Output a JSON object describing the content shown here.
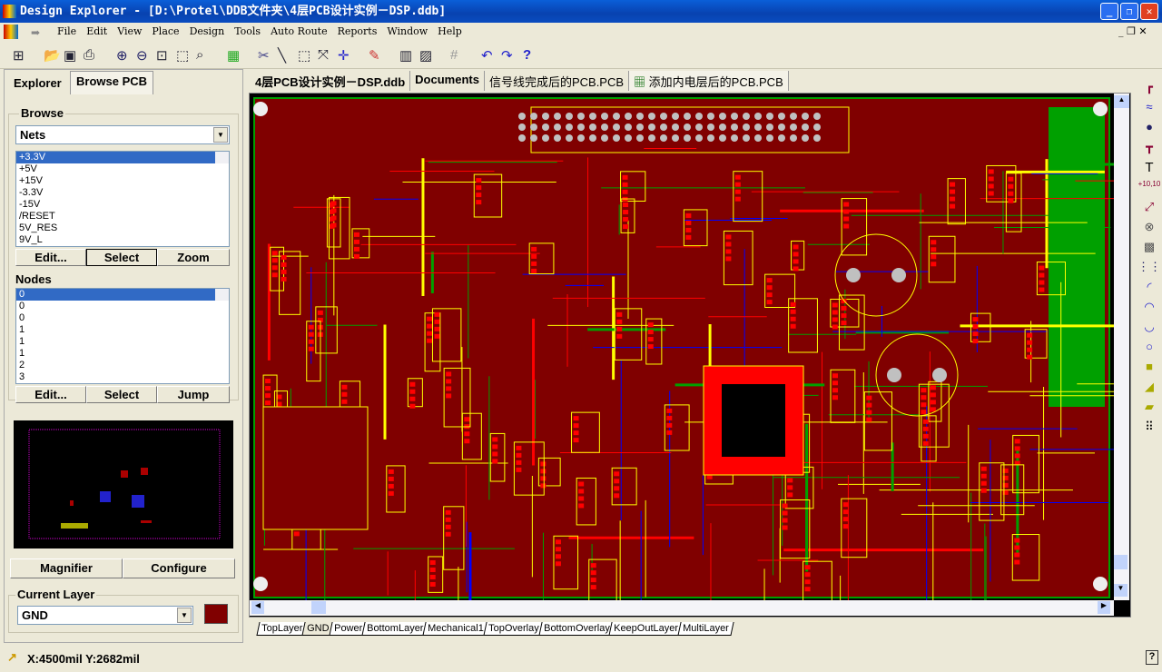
{
  "window": {
    "title": "Design Explorer - [D:\\Protel\\DDB文件夹\\4层PCB设计实例－DSP.ddb]"
  },
  "menu": [
    "File",
    "Edit",
    "View",
    "Place",
    "Design",
    "Tools",
    "Auto Route",
    "Reports",
    "Window",
    "Help"
  ],
  "left_panel": {
    "tabs": [
      "Explorer",
      "Browse PCB"
    ],
    "active_tab": "Browse PCB",
    "browse_label": "Browse",
    "browse_value": "Nets",
    "nets": [
      "+3.3V",
      "+5V",
      "+15V",
      "-3.3V",
      "-15V",
      "/RESET",
      "5V_RES",
      "9V_L"
    ],
    "net_buttons": [
      "Edit...",
      "Select",
      "Zoom"
    ],
    "nodes_label": "Nodes",
    "nodes": [
      "0",
      "0",
      "0",
      "1",
      "1",
      "1",
      "2",
      "3"
    ],
    "node_buttons": [
      "Edit...",
      "Select",
      "Jump"
    ],
    "magnifier_label": "Magnifier",
    "configure_label": "Configure",
    "current_layer_label": "Current Layer",
    "current_layer": "GND",
    "current_layer_color": "#800000"
  },
  "doc_tabs": [
    "4层PCB设计实例－DSP.ddb",
    "Documents",
    "信号线完成后的PCB.PCB",
    "添加内电层后的PCB.PCB"
  ],
  "active_doc_tab": "添加内电层后的PCB.PCB",
  "layer_tabs": [
    "TopLayer",
    "GND",
    "Power",
    "BottomLayer",
    "Mechanical1",
    "TopOverlay",
    "BottomOverlay",
    "KeepOutLayer",
    "MultiLayer"
  ],
  "active_layer_tab": "GND",
  "status": {
    "coords": "X:4500mil Y:2682mil"
  },
  "colors": {
    "board": "#800000",
    "top": "#ff0000",
    "bottom": "#0000ff",
    "overlay": "#ffff00",
    "keepout": "#00a000",
    "pad": "#c0c0c0"
  }
}
